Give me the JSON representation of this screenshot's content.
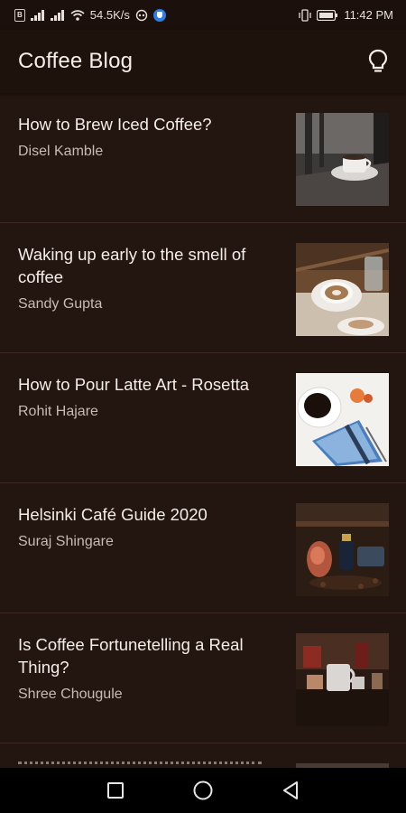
{
  "status_bar": {
    "carrier_badge": "B",
    "speed": "54.5K/s",
    "time": "11:42 PM"
  },
  "app_bar": {
    "title": "Coffee Blog"
  },
  "posts": [
    {
      "title": "How to Brew Iced Coffee?",
      "author": "Disel Kamble"
    },
    {
      "title": "Waking up early to the smell of coffee",
      "author": "Sandy Gupta"
    },
    {
      "title": "How to Pour Latte Art - Rosetta",
      "author": "Rohit Hajare"
    },
    {
      "title": "Helsinki Café Guide 2020",
      "author": "Suraj Shingare"
    },
    {
      "title": "Is Coffee Fortunetelling a Real Thing?",
      "author": "Shree Chougule"
    }
  ],
  "colors": {
    "background": "#231510",
    "app_bar": "#1e120d",
    "divider": "#3a2820"
  },
  "icons": {
    "app_bar_action": "lightbulb-icon",
    "nav": [
      "recents-square-icon",
      "home-circle-icon",
      "back-triangle-icon"
    ]
  }
}
